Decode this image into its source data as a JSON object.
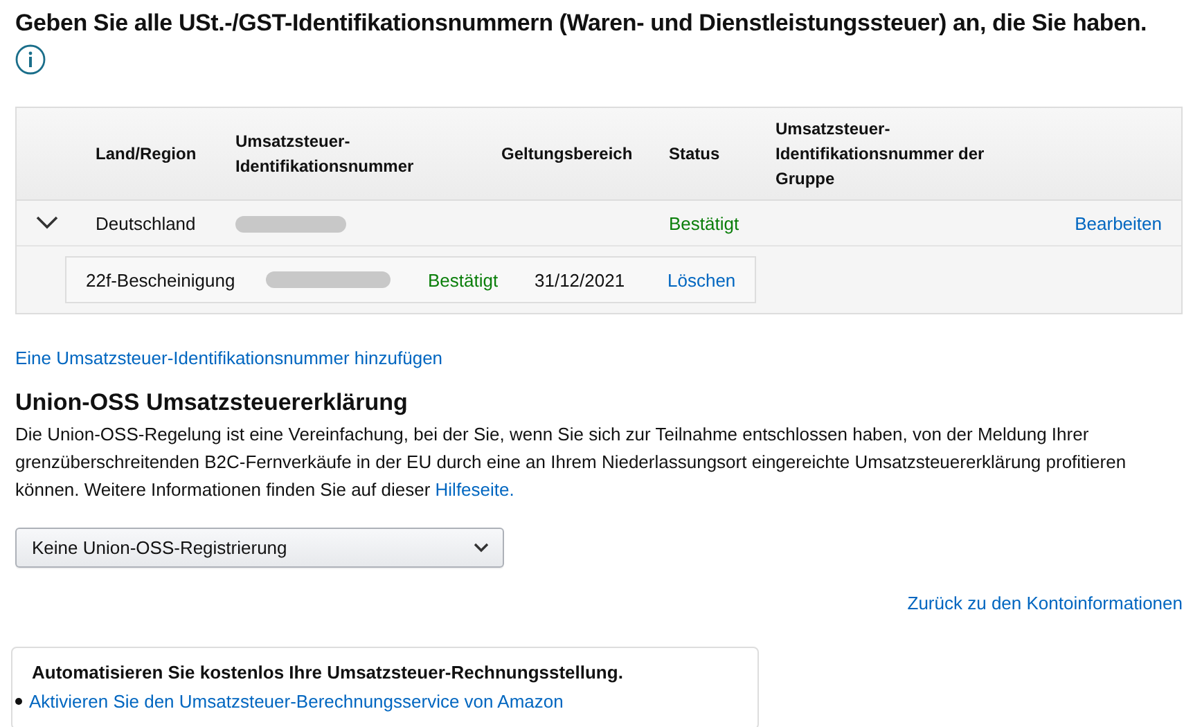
{
  "title": "Geben Sie alle USt.-/GST-Identifikationsnummern (Waren- und Dienstleistungssteuer) an, die Sie haben.",
  "table": {
    "columns": [
      "Land/Region",
      "Umsatzsteuer-Identifikationsnummer",
      "Geltungsbereich",
      "Status",
      "Umsatzsteuer-Identifikationsnummer der Gruppe"
    ],
    "rows": [
      {
        "expanded": true,
        "country": "Deutschland",
        "status": "Bestätigt",
        "action": "Bearbeiten",
        "children": [
          {
            "document": "22f-Bescheinigung",
            "status": "Bestätigt",
            "date": "31/12/2021",
            "action": "Löschen"
          }
        ]
      }
    ]
  },
  "add_link": "Eine Umsatzsteuer-Identifikationsnummer hinzufügen",
  "oss": {
    "heading": "Union-OSS Umsatzsteuererklärung",
    "text": "Die Union-OSS-Regelung ist eine Vereinfachung, bei der Sie, wenn Sie sich zur Teilnahme entschlossen haben, von der Meldung Ihrer grenzüberschreitenden B2C-Fernverkäufe in der EU durch eine an Ihrem Niederlassungsort eingereichte Umsatzsteuererklärung profitieren können. Weitere Informationen finden Sie auf dieser",
    "link": "Hilfeseite.",
    "select": {
      "value": "Keine Union-OSS-Registrierung"
    }
  },
  "back_link": "Zurück zu den Kontoinformationen",
  "card": {
    "heading": "Automatisieren Sie kostenlos Ihre Umsatzsteuer-Rechnungsstellung.",
    "items": [
      "Aktivieren Sie den Umsatzsteuer-Berechnungsservice von Amazon"
    ]
  }
}
